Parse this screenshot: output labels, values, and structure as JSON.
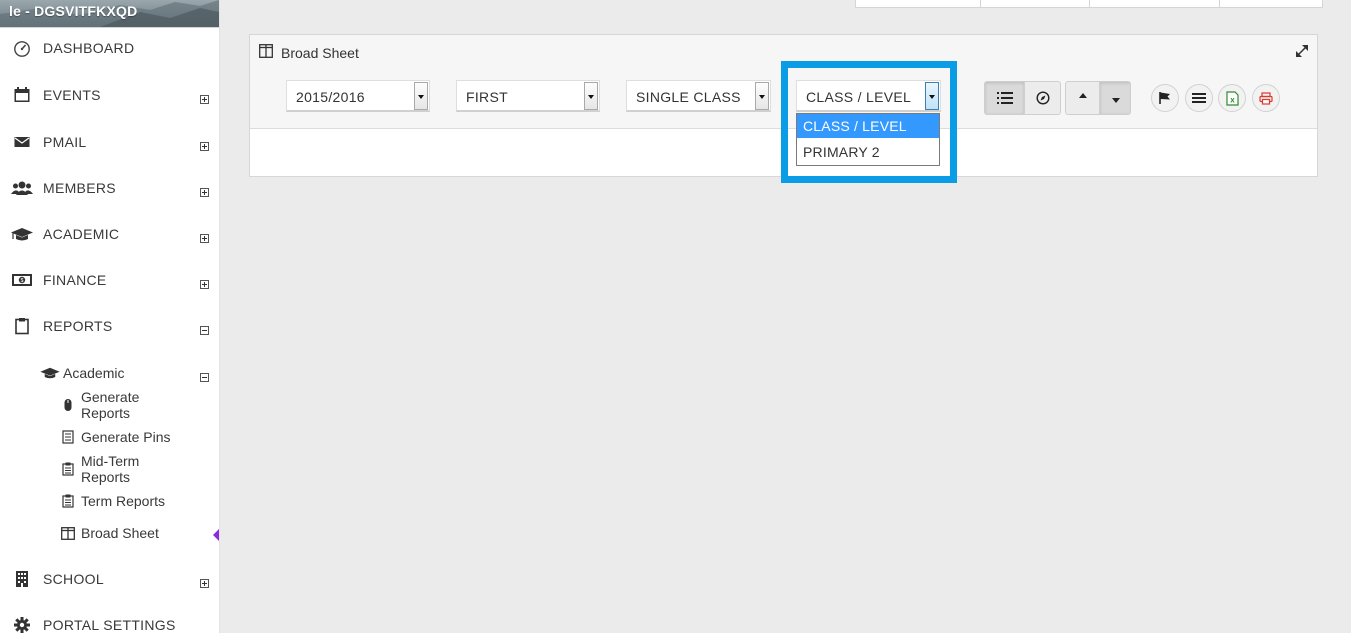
{
  "sidebar": {
    "banner_text": "le - DGSVITFKXQD",
    "items": [
      {
        "label": "DASHBOARD",
        "icon": "dashboard-icon",
        "toggle": ""
      },
      {
        "label": "EVENTS",
        "icon": "calendar-icon",
        "toggle": "expand"
      },
      {
        "label": "PMAIL",
        "icon": "envelope-icon",
        "toggle": "expand"
      },
      {
        "label": "MEMBERS",
        "icon": "users-icon",
        "toggle": "expand"
      },
      {
        "label": "ACADEMIC",
        "icon": "graduation-cap-icon",
        "toggle": "expand"
      },
      {
        "label": "FINANCE",
        "icon": "money-icon",
        "toggle": "expand"
      },
      {
        "label": "REPORTS",
        "icon": "clipboard-icon",
        "toggle": "collapse"
      },
      {
        "label": "SCHOOL",
        "icon": "building-icon",
        "toggle": "expand"
      },
      {
        "label": "PORTAL SETTINGS",
        "icon": "gear-icon",
        "toggle": ""
      }
    ],
    "reports_sub": {
      "academic_label": "Academic",
      "children": [
        {
          "label": "Generate Reports",
          "icon": "mouse-icon"
        },
        {
          "label": "Generate Pins",
          "icon": "list-icon"
        },
        {
          "label": "Mid-Term Reports",
          "icon": "document-icon"
        },
        {
          "label": "Term Reports",
          "icon": "document-icon"
        },
        {
          "label": "Broad Sheet",
          "icon": "columns-icon",
          "active": true
        }
      ]
    }
  },
  "panel": {
    "title": "Broad Sheet",
    "selects": {
      "session": "2015/2016",
      "term": "FIRST",
      "mode": "SINGLE CLASS",
      "class_level": "CLASS / LEVEL"
    },
    "class_dropdown_options": [
      "CLASS / LEVEL",
      "PRIMARY 2"
    ],
    "toolbar": {
      "view_group": [
        "list-view-icon",
        "compass-icon"
      ],
      "sort_group": [
        "sort-asc-icon",
        "sort-desc-icon"
      ],
      "actions": [
        "flag-icon",
        "menu-icon",
        "excel-icon",
        "print-icon"
      ]
    }
  },
  "colors": {
    "highlight": "#0a9de6",
    "dropdown_selected": "#3399ff",
    "active_marker": "#8a2be2"
  }
}
